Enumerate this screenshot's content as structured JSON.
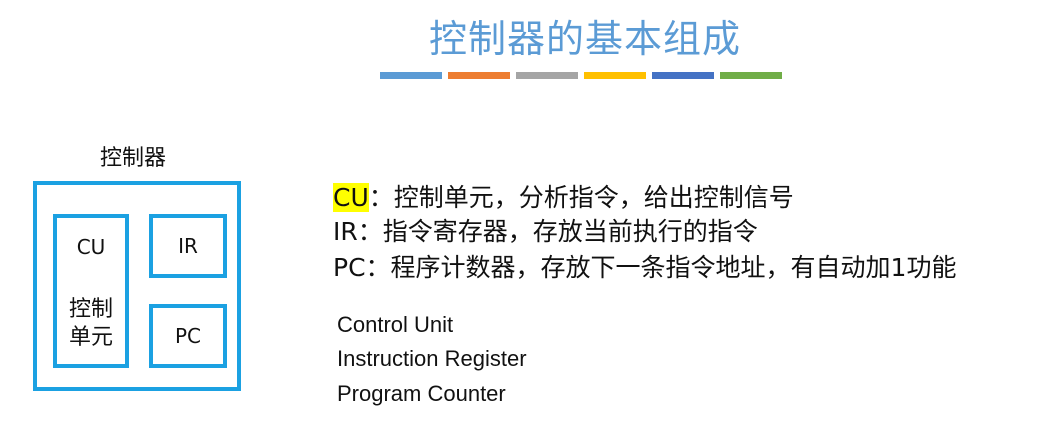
{
  "title": "控制器的基本组成",
  "color_bar": [
    "#5b9bd5",
    "#ed7d31",
    "#a5a5a5",
    "#ffc000",
    "#4472c4",
    "#70ad47"
  ],
  "diagram": {
    "caption": "控制器",
    "cu_abbr": "CU",
    "cu_name_line1": "控制",
    "cu_name_line2": "单元",
    "ir": "IR",
    "pc": "PC",
    "border_color": "#1ba1e2"
  },
  "descriptions": [
    {
      "abbr": "CU",
      "text": "：控制单元，分析指令，给出控制信号",
      "highlight": "#ffff00"
    },
    {
      "abbr": "IR",
      "text": "：指令寄存器，存放当前执行的指令"
    },
    {
      "abbr": "PC",
      "text": "：程序计数器，存放下一条指令地址，有自动加1功能"
    }
  ],
  "full_names": [
    "Control Unit",
    "Instruction Register",
    "Program Counter"
  ]
}
